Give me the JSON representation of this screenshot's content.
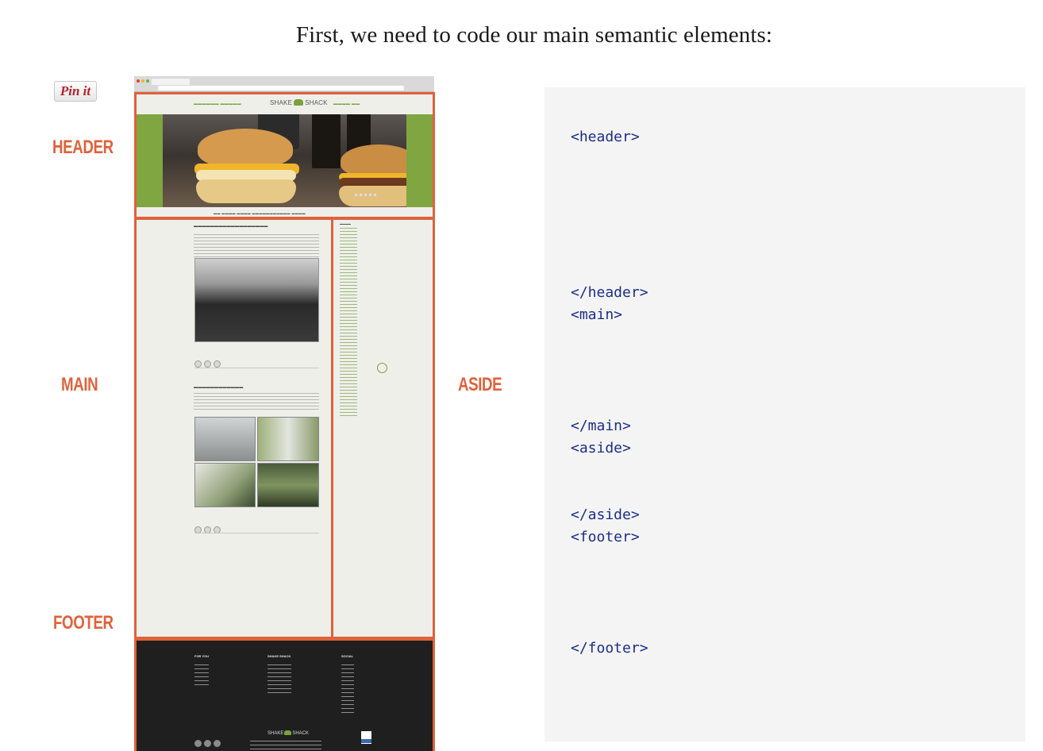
{
  "heading": "First, we need to code our main semantic elements:",
  "pin_button": {
    "label": "Pin it"
  },
  "section_labels": {
    "header": "HEADER",
    "main": "MAIN",
    "aside": "ASIDE",
    "footer": "FOOTER"
  },
  "mock_site": {
    "logo_left": "SHAKE",
    "logo_right": "SHACK",
    "footer_columns": [
      "FOR YOU",
      "SHAKE SHACK",
      "SOCIAL"
    ]
  },
  "code_lines": {
    "header_open": "<header>",
    "header_close": "</header>",
    "main_open": "<main>",
    "main_close": "</main>",
    "aside_open": "<aside>",
    "aside_close": "</aside>",
    "footer_open": "<footer>",
    "footer_close": "</footer>"
  },
  "colors": {
    "label_orange": "#e0623b",
    "code_blue": "#1c2e8a",
    "panel_grey": "#f4f4f4",
    "brand_green": "#7aa13a"
  }
}
